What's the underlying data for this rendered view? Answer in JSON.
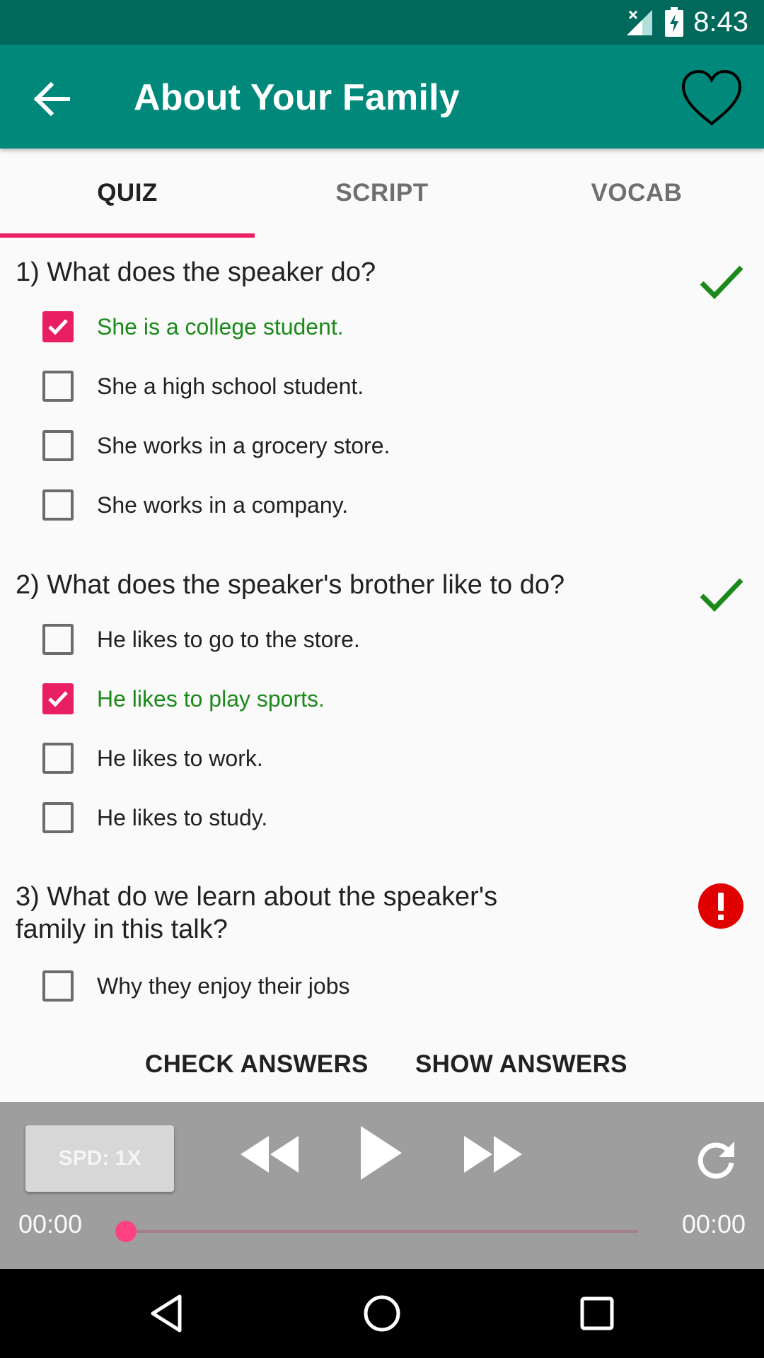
{
  "status_bar": {
    "time": "8:43"
  },
  "app_bar": {
    "title": "About Your Family"
  },
  "tabs": [
    {
      "label": "QUIZ",
      "active": true
    },
    {
      "label": "SCRIPT",
      "active": false
    },
    {
      "label": "VOCAB",
      "active": false
    }
  ],
  "questions": [
    {
      "text": "1) What does the speaker do?",
      "status": "correct",
      "options": [
        {
          "label": "She is a college student.",
          "checked": true,
          "correct": true
        },
        {
          "label": "She a high school student.",
          "checked": false
        },
        {
          "label": "She works in a grocery store.",
          "checked": false
        },
        {
          "label": "She works in a company.",
          "checked": false
        }
      ]
    },
    {
      "text": "2) What does the speaker's brother like to do?",
      "status": "correct",
      "options": [
        {
          "label": "He likes to go to the store.",
          "checked": false
        },
        {
          "label": "He likes to play sports.",
          "checked": true,
          "correct": true
        },
        {
          "label": "He likes to work.",
          "checked": false
        },
        {
          "label": "He likes to study.",
          "checked": false
        }
      ]
    },
    {
      "text_line1": "3) What do we learn about the speaker's",
      "text_line2": "family in this talk?",
      "status": "error",
      "options": [
        {
          "label": "Why they enjoy their jobs",
          "checked": false
        }
      ]
    }
  ],
  "actions": {
    "check_label": "CHECK ANSWERS",
    "show_label": "SHOW ANSWERS"
  },
  "player": {
    "speed_label": "SPD: 1X",
    "elapsed": "00:00",
    "total": "00:00",
    "progress": 0
  },
  "colors": {
    "status_bar": "#00695c",
    "app_bar": "#00897b",
    "accent": "#e91e63",
    "correct": "#1b8a1b",
    "error": "#e10000",
    "player_bg": "#9e9e9e"
  },
  "icons": {
    "back": "arrow-left-icon",
    "favorite": "heart-outline-icon",
    "correct": "checkmark-icon",
    "error": "exclamation-icon",
    "rewind": "rewind-icon",
    "play": "play-icon",
    "forward": "fast-forward-icon",
    "replay": "replay-icon"
  }
}
